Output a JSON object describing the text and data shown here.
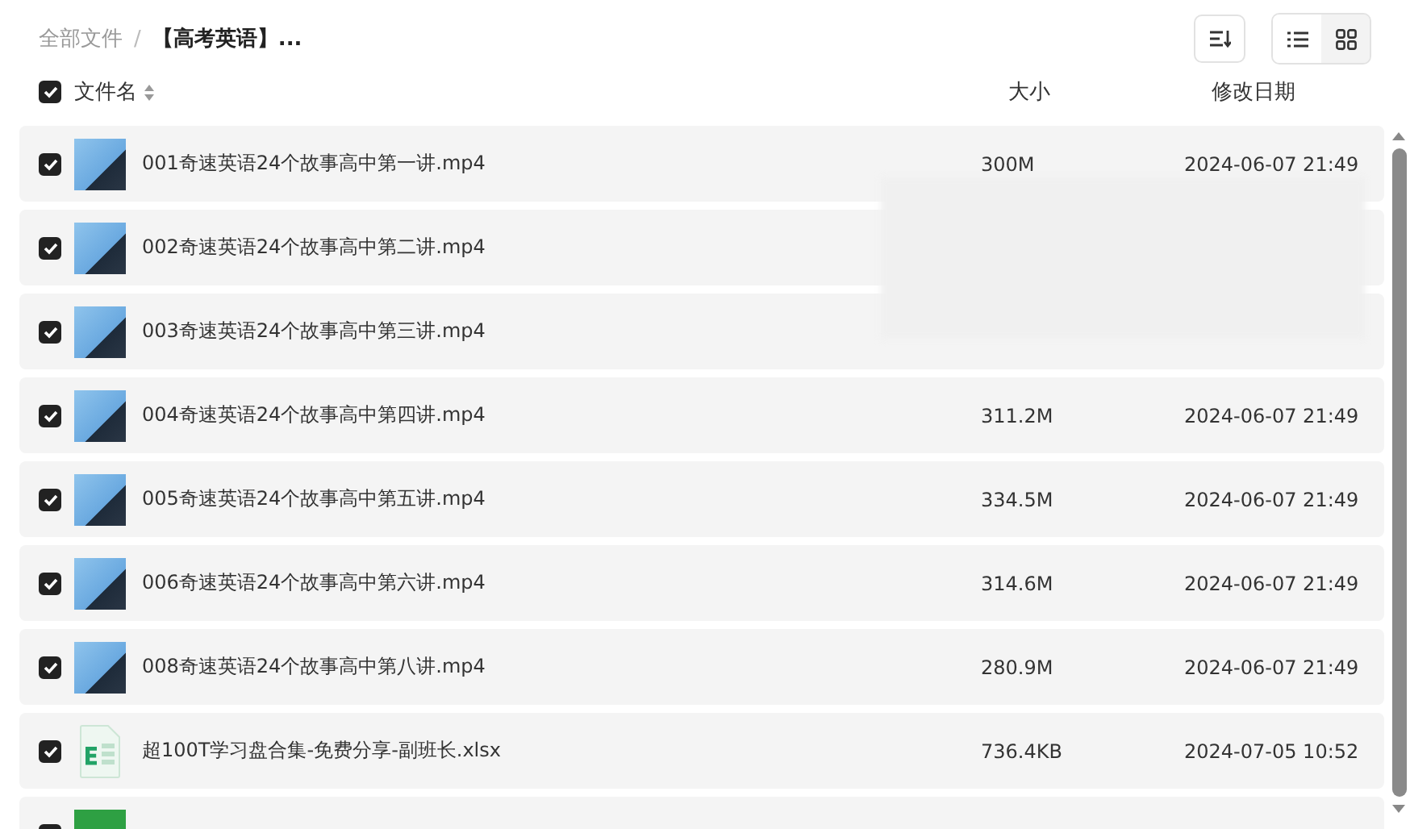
{
  "breadcrumb_separator": "/",
  "breadcrumb": [
    {
      "label": "全部文件",
      "current": false
    },
    {
      "label": "【高考英语】...",
      "current": true
    }
  ],
  "view_modes": [
    {
      "kind": "list",
      "selected": true
    },
    {
      "kind": "grid",
      "selected": false
    }
  ],
  "header": {
    "checked": true,
    "name": "文件名",
    "size": "大小",
    "date": "修改日期"
  },
  "rows": [
    {
      "kind": "video",
      "checked": true,
      "name": "001奇速英语24个故事高中第一讲.mp4",
      "size": "300M",
      "date": "2024-06-07 21:49"
    },
    {
      "kind": "video",
      "checked": true,
      "name": "002奇速英语24个故事高中第二讲.mp4"
    },
    {
      "kind": "video",
      "checked": true,
      "name": "003奇速英语24个故事高中第三讲.mp4"
    },
    {
      "kind": "video",
      "checked": true,
      "name": "004奇速英语24个故事高中第四讲.mp4",
      "size": "311.2M",
      "date": "2024-06-07 21:49"
    },
    {
      "kind": "video",
      "checked": true,
      "name": "005奇速英语24个故事高中第五讲.mp4",
      "size": "334.5M",
      "date": "2024-06-07 21:49"
    },
    {
      "kind": "video",
      "checked": true,
      "name": "006奇速英语24个故事高中第六讲.mp4",
      "size": "314.6M",
      "date": "2024-06-07 21:49"
    },
    {
      "kind": "video",
      "checked": true,
      "name": "008奇速英语24个故事高中第八讲.mp4",
      "size": "280.9M",
      "date": "2024-06-07 21:49"
    },
    {
      "kind": "sheet",
      "checked": true,
      "name": "超100T学习盘合集-免费分享-副班长.xlsx",
      "size": "736.4KB",
      "date": "2024-07-05 10:52"
    },
    {
      "kind": "image",
      "checked": true
    }
  ]
}
